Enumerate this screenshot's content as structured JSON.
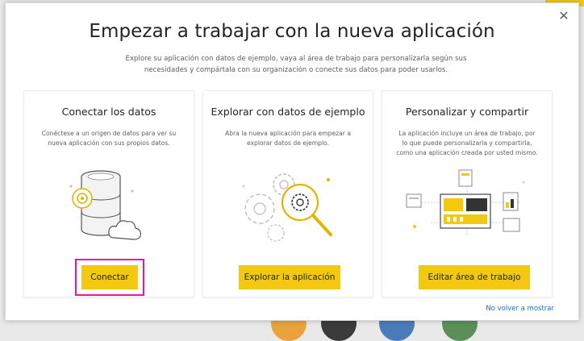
{
  "dialog": {
    "title": "Empezar a trabajar con la nueva aplicación",
    "subtitle": "Explore su aplicación con datos de ejemplo, vaya al área de trabajo para personalizarla según sus necesidades y compártala con su organización o conecte sus datos para poder usarlos.",
    "close_icon": "close-icon",
    "footer_link": "No volver a mostrar"
  },
  "cards": [
    {
      "title": "Conectar los datos",
      "description": "Conéctese a un origen de datos para ver su nueva aplicación con sus propios datos.",
      "button": "Conectar",
      "icon": "database-cloud-icon"
    },
    {
      "title": "Explorar con datos de ejemplo",
      "description": "Abra la nueva aplicación para empezar a explorar datos de ejemplo.",
      "button": "Explorar la aplicación",
      "icon": "gears-magnifier-icon"
    },
    {
      "title": "Personalizar y compartir",
      "description": "La aplicación incluye un área de trabajo, por lo que puede personalizarla y compartirla, como una aplicación creada por usted mismo.",
      "button": "Editar área de trabajo",
      "icon": "dashboard-network-icon"
    }
  ],
  "colors": {
    "accent": "#f2c811",
    "highlight": "#e616a8",
    "link": "#1a6fc5"
  }
}
